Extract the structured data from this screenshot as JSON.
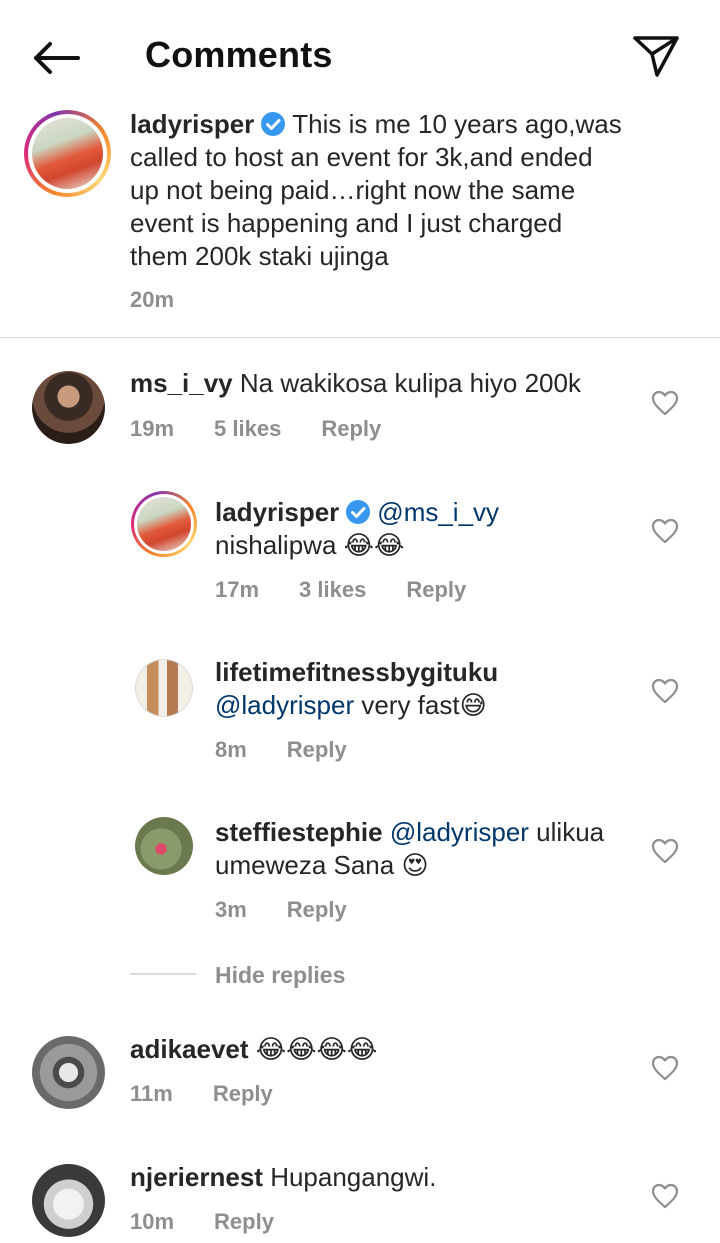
{
  "header": {
    "title": "Comments"
  },
  "caption": {
    "username": "ladyrisper",
    "text_line1": "This is me 10 years ago,was",
    "text_line2": "called to host an event for 3k,and ended",
    "text_line3": "up not being paid…right now the same",
    "text_line4": "event is happening and I just charged",
    "text_line5": "them 200k staki ujinga",
    "time": "20m"
  },
  "comments": [
    {
      "username": "ms_i_vy",
      "text": "Na wakikosa kulipa hiyo 200k",
      "time": "19m",
      "likes": "5 likes",
      "reply": "Reply"
    },
    {
      "username": "ladyrisper",
      "mention": "@ms_i_vy",
      "text": "nishalipwa",
      "emoji": "😂😂",
      "time": "17m",
      "likes": "3 likes",
      "reply": "Reply"
    },
    {
      "username": "lifetimefitnessbygituku",
      "mention": "@ladyrisper",
      "text": " very fast",
      "emoji": "😅",
      "time": "8m",
      "reply": "Reply"
    },
    {
      "username": "steffiestephie",
      "mention": "@ladyrisper",
      "text": " ulikua",
      "text_line2": "umeweza Sana",
      "emoji": "😍",
      "time": "3m",
      "reply": "Reply"
    },
    {
      "username": "adikaevet",
      "emoji": "😂😂😂😂",
      "time": "11m",
      "reply": "Reply"
    },
    {
      "username": "njeriernest",
      "text": "Hupangangwi.",
      "time": "10m",
      "reply": "Reply"
    }
  ],
  "hide_replies": "Hide replies",
  "icons": {
    "back": "arrow-left-icon",
    "send": "paper-plane-icon",
    "verified": "verified-badge-icon",
    "heart": "heart-outline-icon"
  },
  "colors": {
    "verified": "#3897f0",
    "mention": "#00376b",
    "meta": "#8e8e8e"
  }
}
